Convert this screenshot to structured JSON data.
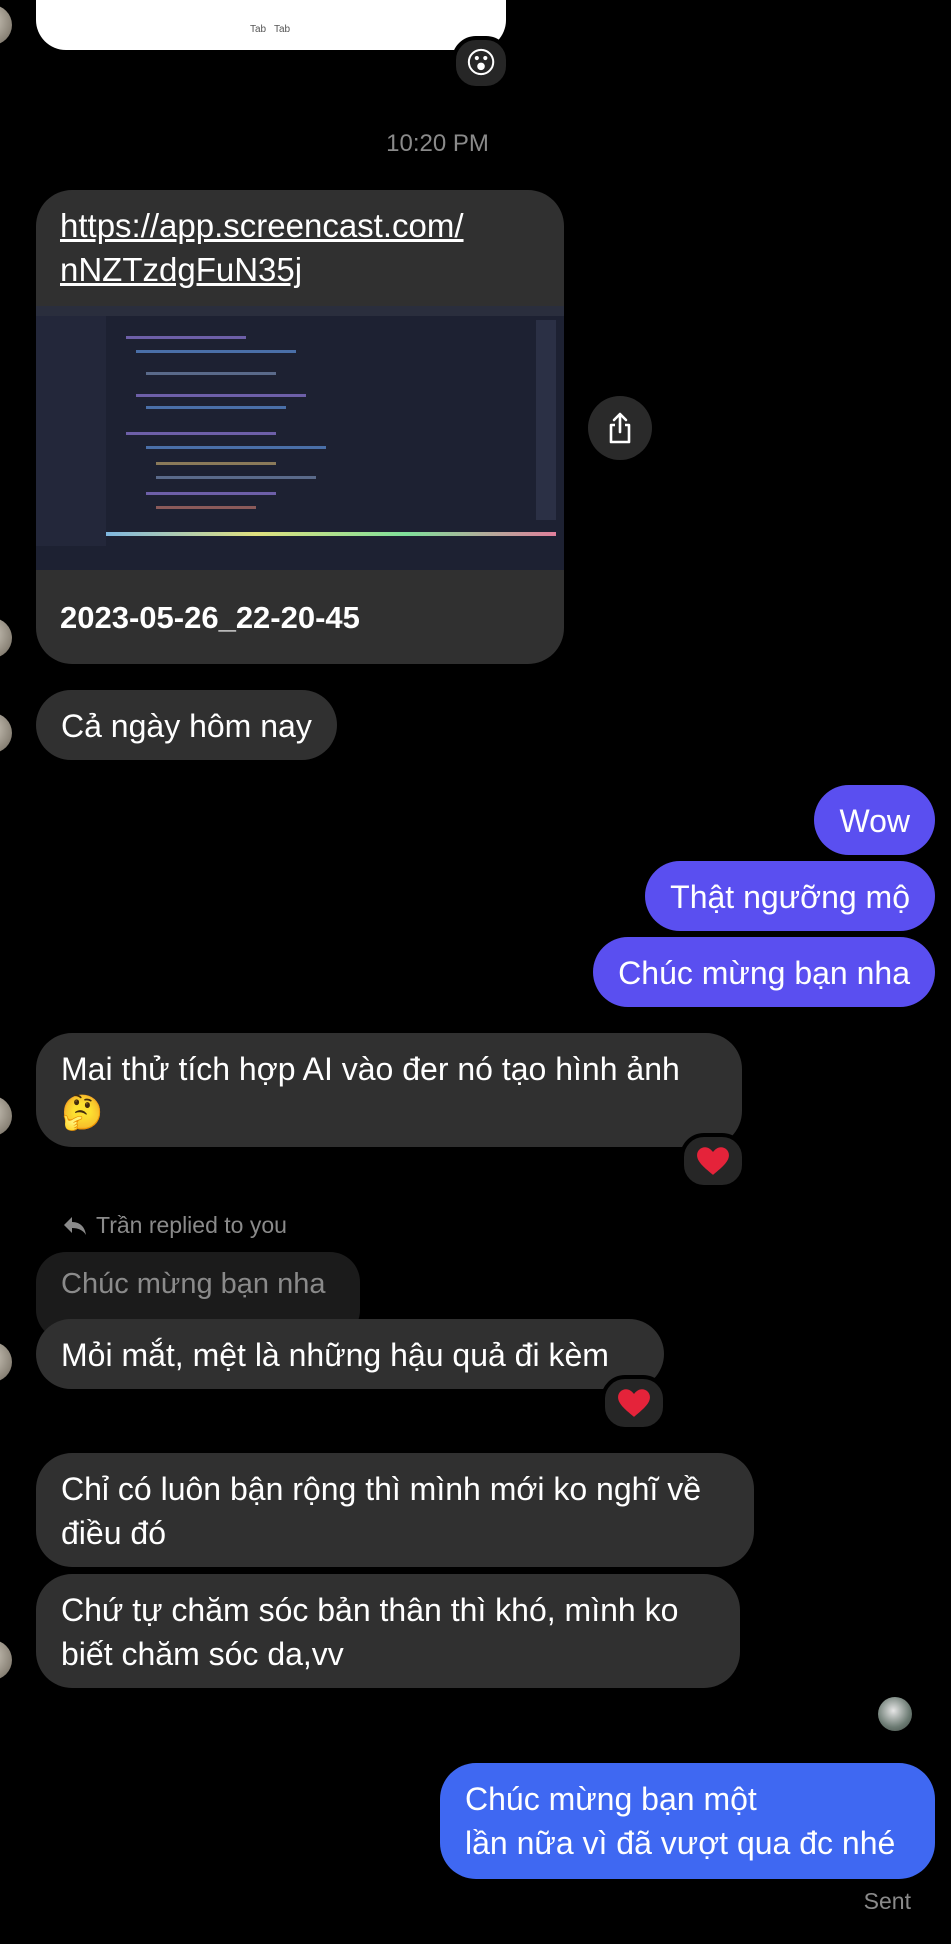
{
  "top_card": {
    "tab_labels": [
      "Tab",
      "Tab"
    ]
  },
  "reactions": {
    "wow_emoji": "😮",
    "heart_emoji": "❤️"
  },
  "timestamp": "10:20 PM",
  "link_card": {
    "url": "https://app.screencast.com/\nnNZTzdgFuN35j",
    "title": "2023-05-26_22-20-45"
  },
  "messages": {
    "in1": "Cả ngày hôm nay",
    "out1": "Wow",
    "out2": "Thật ngưỡng mộ",
    "out3": "Chúc mừng bạn nha",
    "in2": "Mai thử tích hợp AI vào đer nó tạo hình ảnh",
    "in2_emoji": "🤔",
    "reply_header": "Trần replied to you",
    "reply_quote": "Chúc mừng bạn nha",
    "in3": "Mỏi mắt, mệt là những hậu quả đi kèm",
    "in4": "Chỉ có luôn bận rộng thì mình mới ko nghĩ về\nđiều đó",
    "in5": "Chứ tự chăm sóc bản thân thì khó, mình ko\nbiết chăm sóc da,vv",
    "out4": "Chúc mừng bạn một\nlần nữa vì đã vượt qua đc nhé",
    "status": "Sent"
  },
  "colors": {
    "incoming": "#303030",
    "outgoing_purple": "#5a4ff0",
    "outgoing_blue": "#3f68f2"
  }
}
